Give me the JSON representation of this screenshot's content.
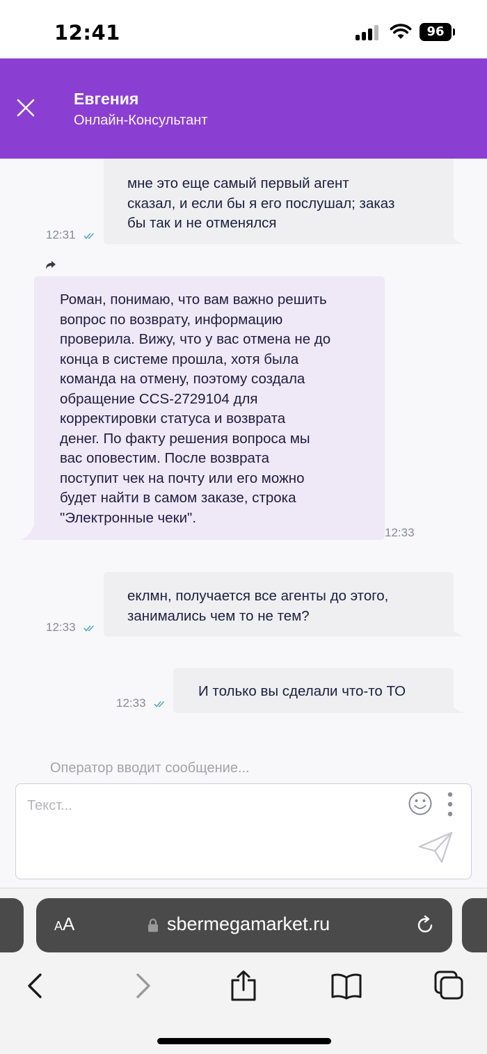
{
  "status_bar": {
    "time": "12:41",
    "battery": "96",
    "icons": [
      "cellular-signal-icon",
      "wifi-icon",
      "battery-icon"
    ]
  },
  "header": {
    "name": "Евгения",
    "role": "Онлайн-Консультант",
    "background": "#8b3fd2",
    "close_icon": "close-icon"
  },
  "messages": [
    {
      "direction": "outgoing",
      "lines": [
        "мне это еще самый первый агент",
        "сказал, и если бы я его послушал; заказ",
        "бы так и не отменялся"
      ],
      "time": "12:31",
      "read": true
    },
    {
      "direction": "incoming",
      "forwarded": true,
      "lines": [
        "Роман, понимаю, что вам важно решить",
        "вопрос по возврату, информацию",
        "проверила. Вижу, что у вас отмена не до",
        "конца в системе прошла, хотя была",
        "команда на отмену, поэтому создала",
        "обращение CCS-2729104 для",
        "корректировки статуса и возврата",
        "денег. По факту решения вопроса мы",
        "вас оповестим. После возврата",
        "поступит чек на почту или его можно",
        "будет найти в самом заказе, строка",
        "\"Электронные чеки\"."
      ],
      "time": "12:33"
    },
    {
      "direction": "outgoing",
      "lines": [
        "еклмн, получается все агенты до этого,",
        "занимались чем то не тем?"
      ],
      "time": "12:33",
      "read": true
    },
    {
      "direction": "outgoing",
      "lines": [
        "И только вы сделали что-то ТО"
      ],
      "time": "12:33",
      "read": true
    }
  ],
  "typing_indicator": "Оператор вводит сообщение...",
  "composer": {
    "placeholder": "Текст...",
    "icons": [
      "emoji-icon",
      "more-vertical-icon",
      "send-icon"
    ]
  },
  "browser": {
    "text_size_label": "AA",
    "url": "sbermegamarket.ru",
    "icons": [
      "lock-icon",
      "reload-icon",
      "back-icon",
      "forward-icon",
      "share-icon",
      "bookmarks-icon",
      "tabs-icon"
    ]
  },
  "colors": {
    "accent": "#8b3fd2",
    "incoming_bubble": "#efe8f7",
    "outgoing_bubble": "#efeff2",
    "read_ticks": "#4aa3c2"
  }
}
